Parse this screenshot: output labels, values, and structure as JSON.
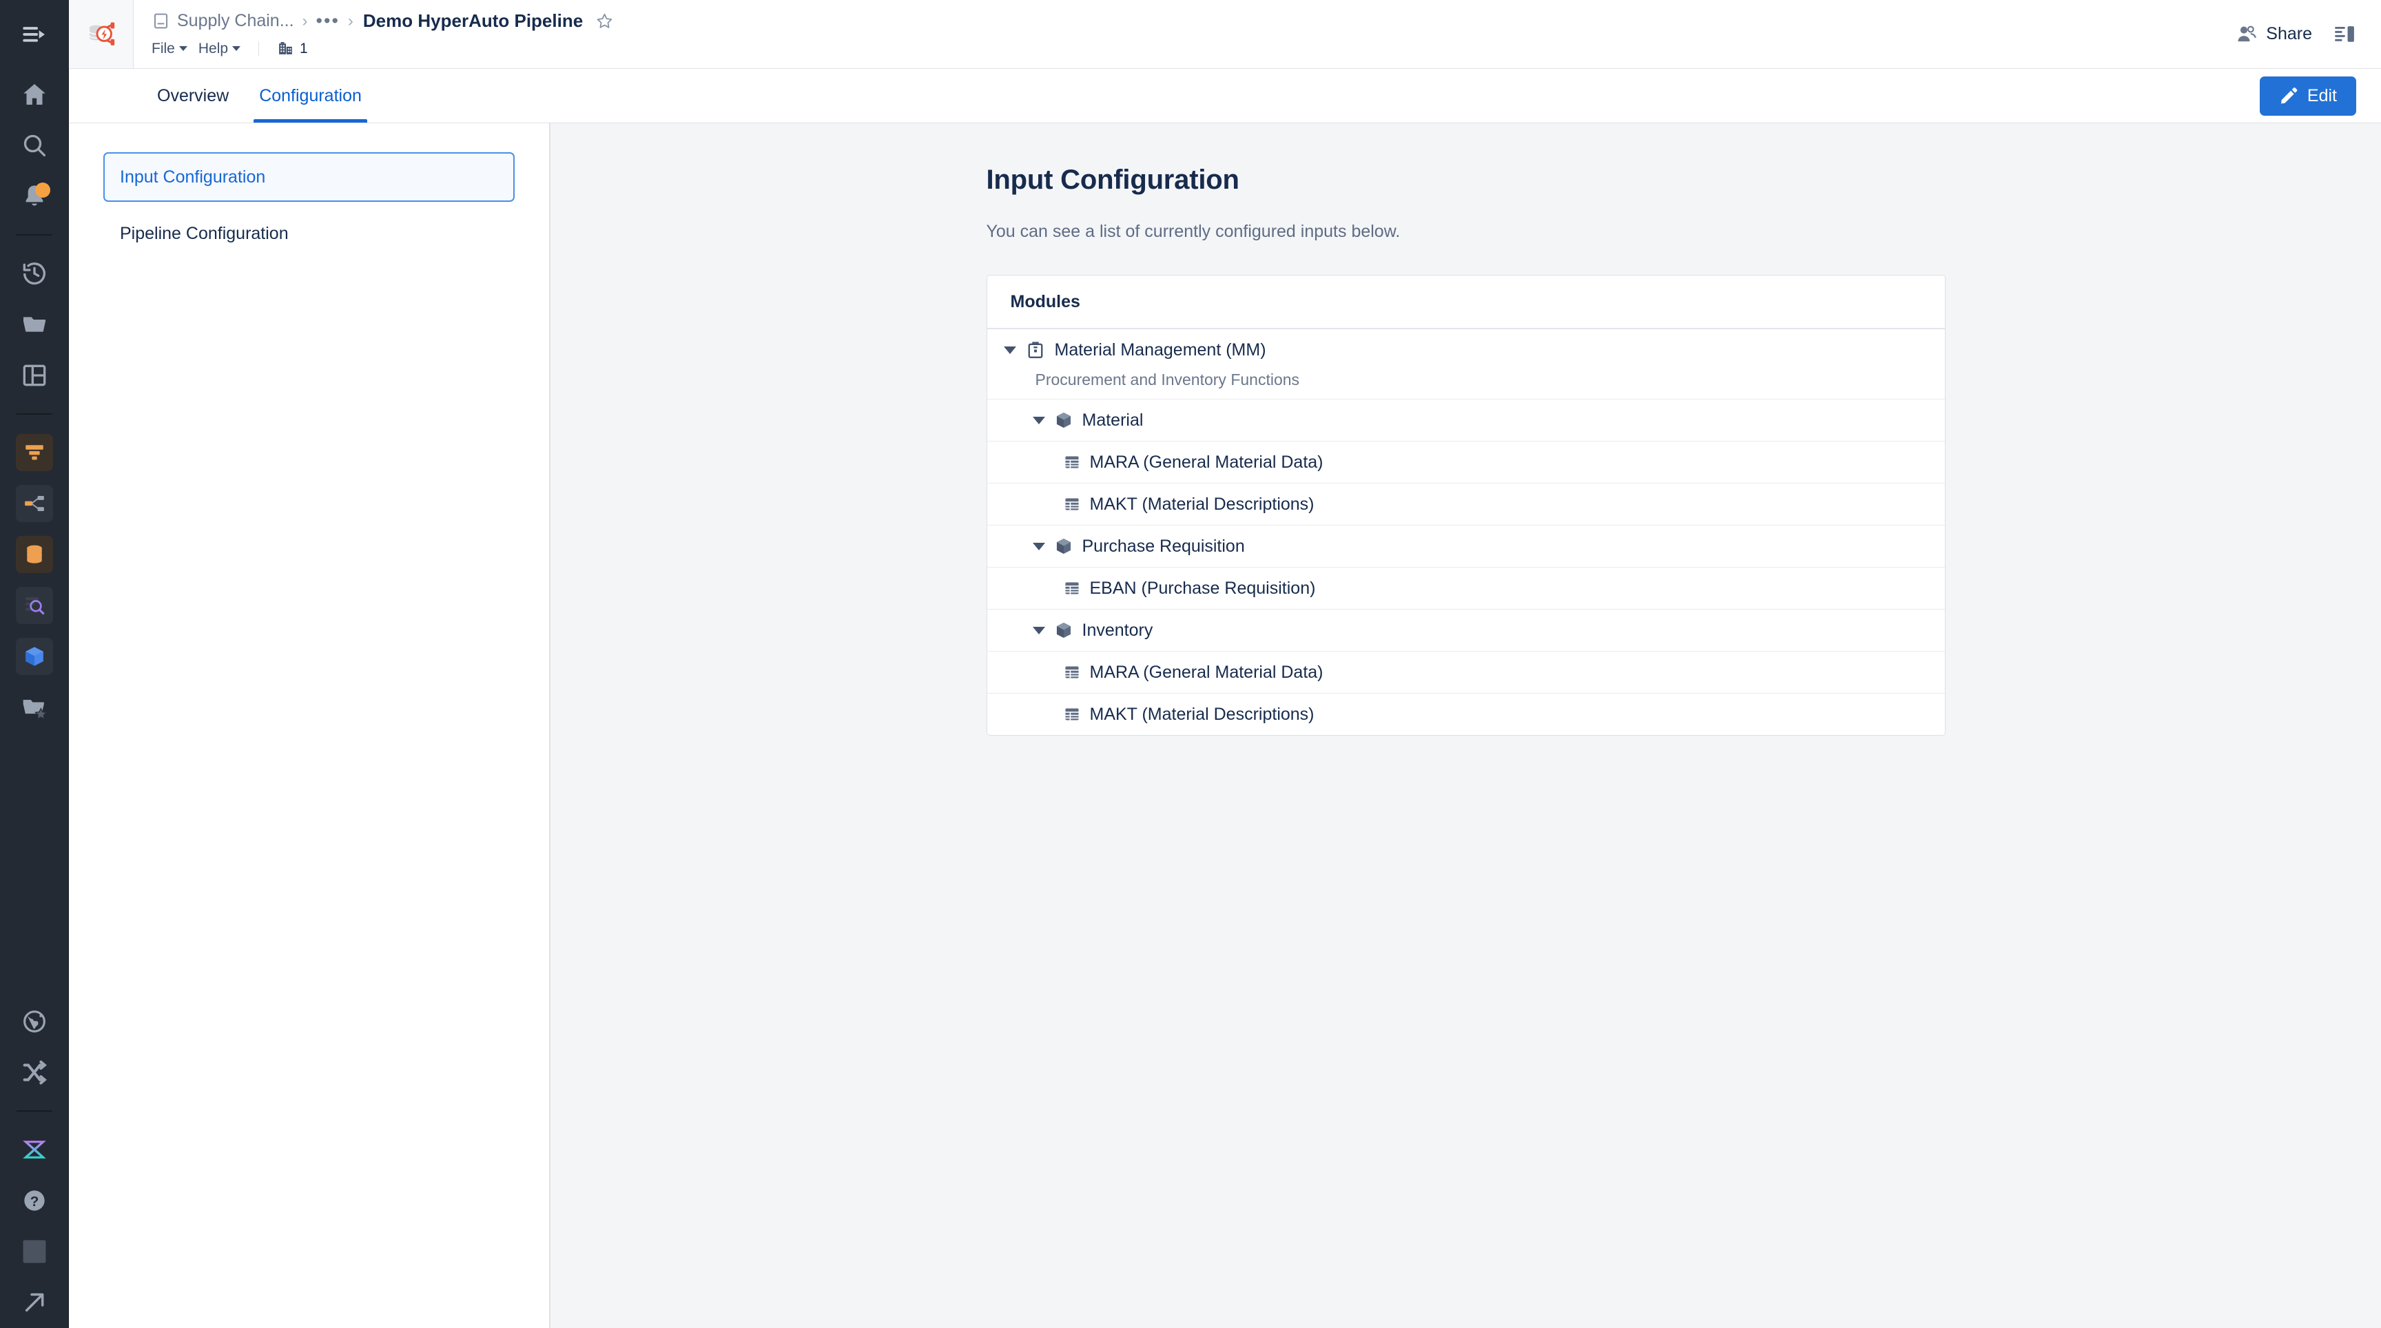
{
  "rail": {
    "toggle": {
      "icon": "sidebar-collapse-icon"
    },
    "items": [
      {
        "name": "home",
        "icon": "home-icon"
      },
      {
        "name": "search",
        "icon": "search-icon"
      },
      {
        "name": "notifications",
        "icon": "bell-icon",
        "badge": true
      },
      {
        "name": "recent",
        "icon": "history-clock-icon"
      },
      {
        "name": "browse",
        "icon": "folder-icon"
      },
      {
        "name": "workspace",
        "icon": "dashboard-panels-icon"
      },
      {
        "name": "pipeline-builder",
        "icon": "funnel-icon"
      },
      {
        "name": "data-lineage",
        "icon": "branch-nodes-icon"
      },
      {
        "name": "datasets",
        "icon": "database-icon"
      },
      {
        "name": "object-explorer",
        "icon": "magnifier-object-icon"
      },
      {
        "name": "ontology",
        "icon": "cube-icon"
      },
      {
        "name": "favorites",
        "icon": "folder-star-icon"
      },
      {
        "name": "globe",
        "icon": "globe-icon"
      },
      {
        "name": "shuffle",
        "icon": "shuffle-icon"
      },
      {
        "name": "app-logo",
        "icon": "hourglass-logo-icon"
      },
      {
        "name": "help",
        "icon": "question-circle-icon"
      },
      {
        "name": "account",
        "icon": "avatar-icon"
      },
      {
        "name": "open-external",
        "icon": "arrow-up-right-icon"
      }
    ]
  },
  "header": {
    "logo_icon": "database-bolt-logo",
    "breadcrumb": {
      "doc_icon": "document-icon",
      "root_label": "Supply Chain...",
      "separator": "›",
      "ellipsis": "•••",
      "title": "Demo HyperAuto Pipeline",
      "star_icon": "star-outline-icon"
    },
    "menus": [
      {
        "label": "File"
      },
      {
        "label": "Help"
      }
    ],
    "org": {
      "icon": "building-icon",
      "count": "1"
    },
    "share": {
      "icon": "people-icon",
      "label": "Share"
    },
    "panel_toggle_icon": "panel-layout-icon"
  },
  "tabs": [
    {
      "label": "Overview",
      "active": false
    },
    {
      "label": "Configuration",
      "active": true
    }
  ],
  "edit_button": {
    "icon": "pencil-icon",
    "label": "Edit"
  },
  "subnav": {
    "items": [
      {
        "label": "Input Configuration",
        "selected": true
      },
      {
        "label": "Pipeline Configuration",
        "selected": false
      }
    ]
  },
  "main": {
    "title": "Input Configuration",
    "description": "You can see a list of currently configured inputs below.",
    "card": {
      "header": "Modules",
      "rows": [
        {
          "level": 0,
          "expandable": true,
          "icon": "module-box-icon",
          "label": "Material Management (MM)",
          "sublabel": "Procurement and Inventory Functions"
        },
        {
          "level": 1,
          "expandable": true,
          "icon": "cube-icon",
          "label": "Material"
        },
        {
          "level": 2,
          "expandable": false,
          "icon": "table-icon",
          "label": "MARA (General Material Data)"
        },
        {
          "level": 2,
          "expandable": false,
          "icon": "table-icon",
          "label": "MAKT (Material Descriptions)"
        },
        {
          "level": 1,
          "expandable": true,
          "icon": "cube-icon",
          "label": "Purchase Requisition"
        },
        {
          "level": 2,
          "expandable": false,
          "icon": "table-icon",
          "label": "EBAN (Purchase Requisition)"
        },
        {
          "level": 1,
          "expandable": true,
          "icon": "cube-icon",
          "label": "Inventory"
        },
        {
          "level": 2,
          "expandable": false,
          "icon": "table-icon",
          "label": "MARA (General Material Data)"
        },
        {
          "level": 2,
          "expandable": false,
          "icon": "table-icon",
          "label": "MAKT (Material Descriptions)"
        }
      ]
    }
  },
  "colors": {
    "accent_blue": "#2271d6",
    "rail_bg": "#242a33",
    "content_bg": "#f4f5f7",
    "text_primary": "#172b4d",
    "text_muted": "#6b778c",
    "badge_orange": "#f5a142",
    "logo_orange": "#e8553a"
  }
}
